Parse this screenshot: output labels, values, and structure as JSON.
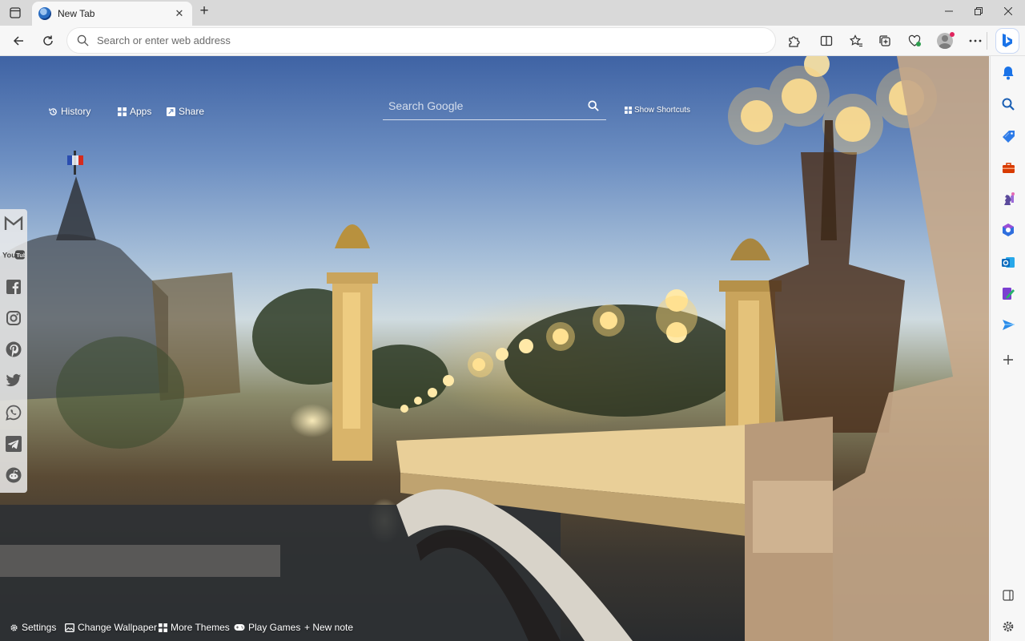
{
  "browser": {
    "tab": {
      "title": "New Tab",
      "close_symbol": "✕"
    },
    "new_tab_symbol": "+",
    "window_controls": {
      "minimize": "—",
      "maximize": "▢",
      "close": "✕"
    },
    "address_bar": {
      "placeholder": "Search or enter web address",
      "value": ""
    }
  },
  "newtab": {
    "top_links": [
      {
        "label": "History",
        "icon": "history-icon"
      },
      {
        "label": "Apps",
        "icon": "apps-grid-icon"
      },
      {
        "label": "Share",
        "icon": "share-icon"
      }
    ],
    "search": {
      "placeholder": "Search Google"
    },
    "show_shortcuts": "Show Shortcuts",
    "social_links": [
      "Gmail",
      "YouTube",
      "Facebook",
      "Instagram",
      "Pinterest",
      "Twitter",
      "WhatsApp",
      "Telegram",
      "Reddit"
    ],
    "bottom_links": [
      {
        "label": "Settings",
        "icon": "gear-icon"
      },
      {
        "label": "Change Wallpaper",
        "icon": "image-icon"
      },
      {
        "label": "More Themes",
        "icon": "grid-icon"
      },
      {
        "label": "Play Games",
        "icon": "gamepad-icon"
      },
      {
        "label": "+ New note",
        "icon": ""
      }
    ],
    "wallpaper": "Pont Alexandre III, Paris at dusk"
  },
  "sidebar": {
    "items": [
      "Notifications",
      "Search",
      "Shopping",
      "Tools",
      "Games",
      "Microsoft 365",
      "Outlook",
      "Drop",
      "Send",
      "Add"
    ],
    "colors": {
      "bing": "#1a73e8",
      "bell": "#1a73e8",
      "outlook": "#0f6cbd",
      "shopping": "#2d7be8",
      "tools": "#d83b01",
      "games": "#7e3fbf"
    }
  }
}
